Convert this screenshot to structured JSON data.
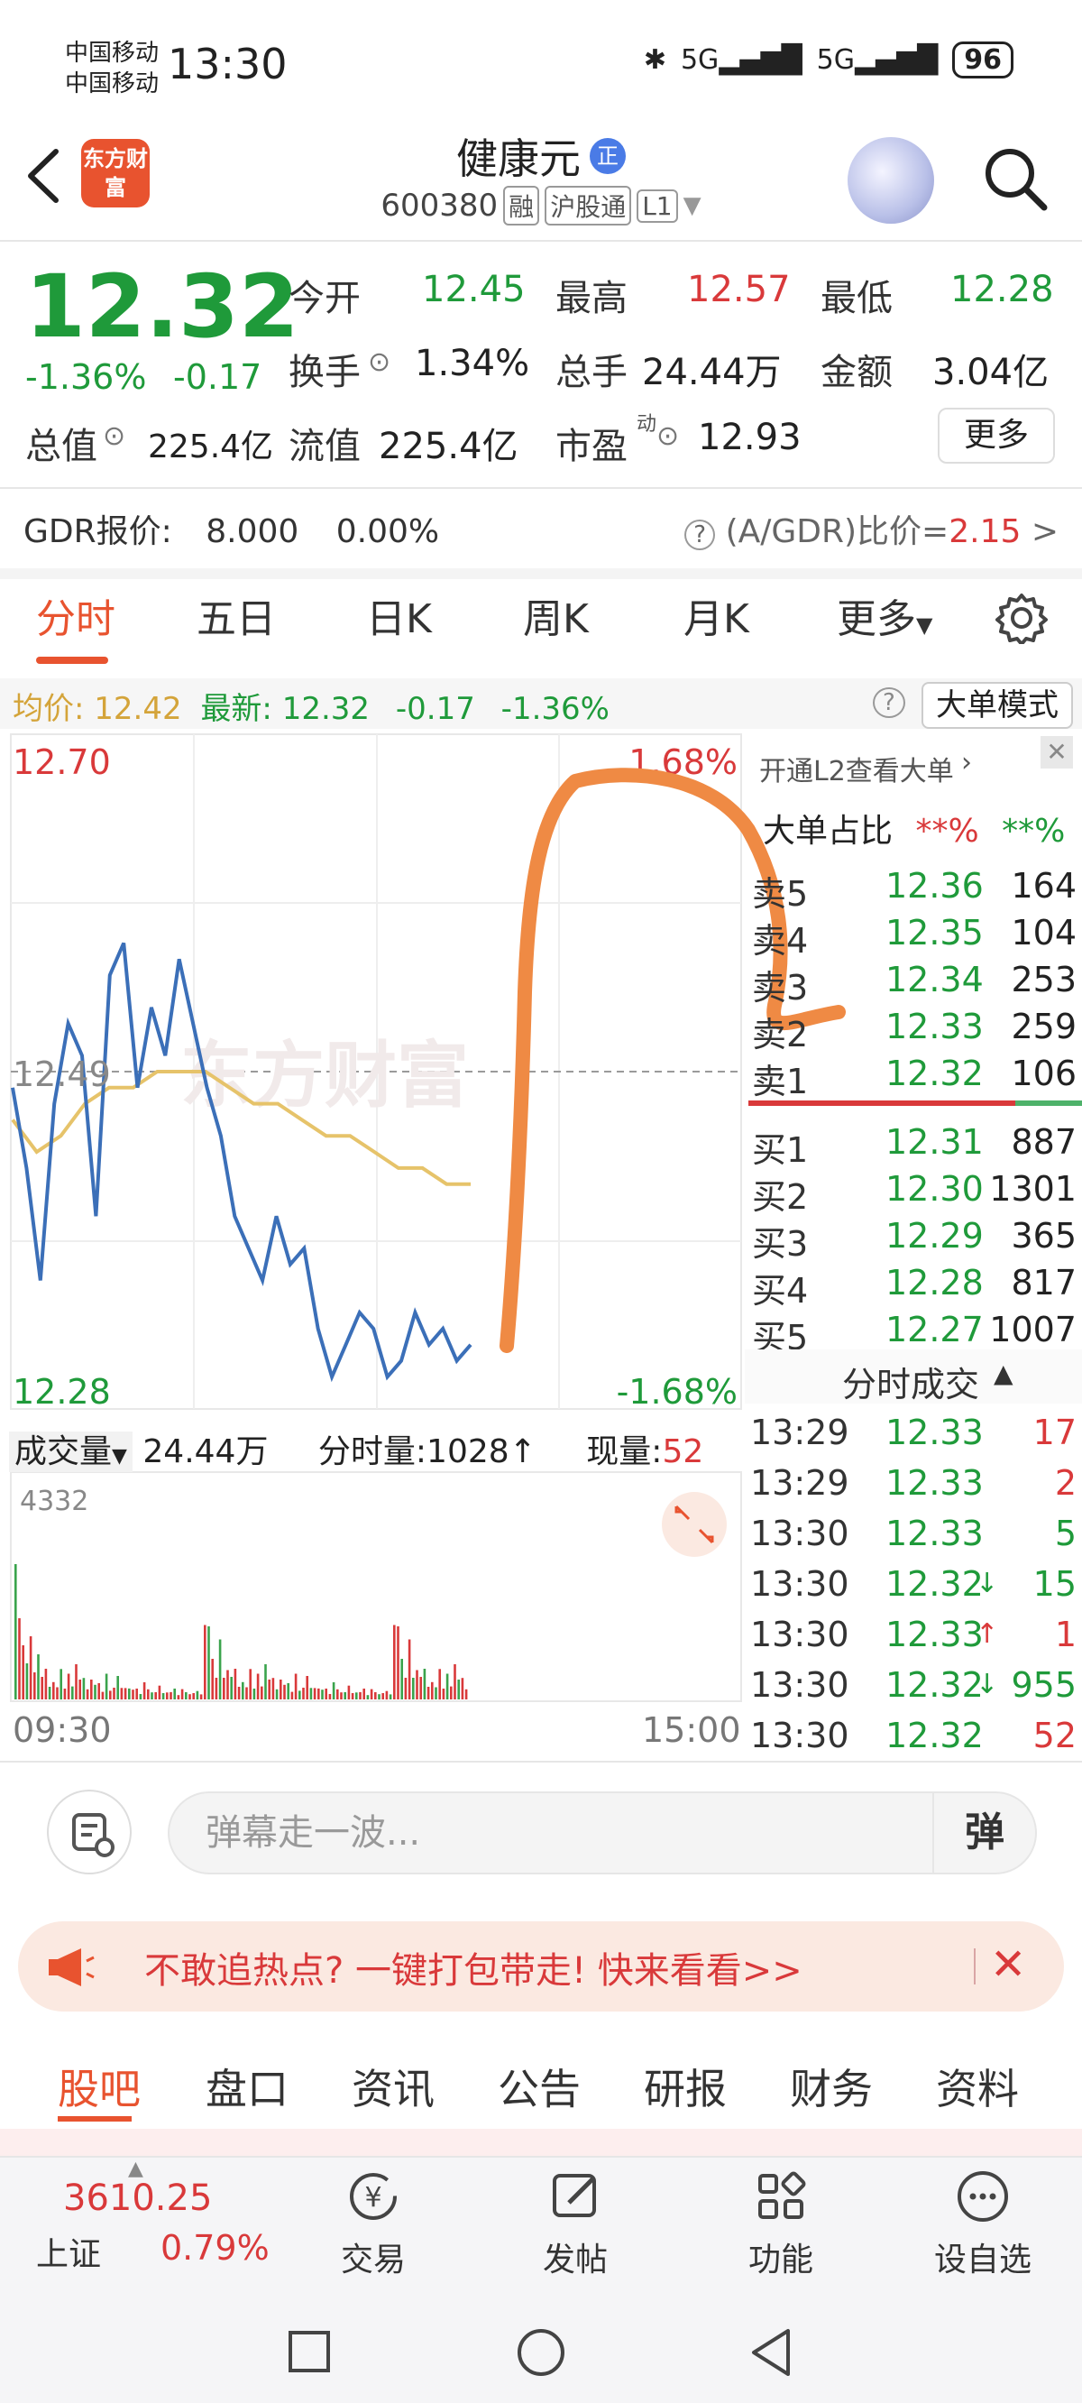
{
  "status_bar": {
    "carrier1": "中国移动",
    "carrier2": "中国移动",
    "time": "13:30",
    "signal1": "5G",
    "signal2": "5G",
    "battery": "96"
  },
  "header": {
    "logo_text": "东方财富",
    "stock_name": "健康元",
    "name_badge": "正",
    "code": "600380",
    "tag1": "融",
    "tag2": "沪股通",
    "tag3": "L1"
  },
  "quote": {
    "price": "12.32",
    "change_pct": "-1.36%",
    "change_abs": "-0.17",
    "open_label": "今开",
    "open": "12.45",
    "high_label": "最高",
    "high": "12.57",
    "low_label": "最低",
    "low": "12.28",
    "turnover_label": "换手",
    "turnover": "1.34%",
    "volume_label": "总手",
    "volume": "24.44万",
    "amount_label": "金额",
    "amount": "3.04亿",
    "mcap_label": "总值",
    "mcap": "225.4亿",
    "float_label": "流值",
    "float": "225.4亿",
    "pe_label": "市盈",
    "pe_sup": "动",
    "pe": "12.93",
    "more": "更多"
  },
  "gdr": {
    "label": "GDR报价:",
    "price": "8.000",
    "pct": "0.00%",
    "ratio_label": "(A/GDR)比价=",
    "ratio": "2.15",
    "arrow": ">"
  },
  "chart_tabs": [
    "分时",
    "五日",
    "日K",
    "周K",
    "月K",
    "更多"
  ],
  "info_strip": {
    "avg_label": "均价:",
    "avg": "12.42",
    "latest_label": "最新:",
    "latest": "12.32",
    "chg": "-0.17",
    "pct": "-1.36%",
    "big_order_mode": "大单模式"
  },
  "chart_labels": {
    "y_top": "12.70",
    "y_mid": "12.49",
    "y_bottom": "12.28",
    "pct_top": "1.68%",
    "pct_bottom": "-1.68%",
    "watermark": "东方财富"
  },
  "chart_data": {
    "type": "line",
    "title": "",
    "ylim": [
      12.28,
      12.7
    ],
    "series": [
      {
        "name": "最新",
        "values": [
          12.48,
          12.43,
          12.36,
          12.47,
          12.52,
          12.5,
          12.4,
          12.55,
          12.57,
          12.48,
          12.53,
          12.5,
          12.56,
          12.52,
          12.48,
          12.45,
          12.4,
          12.38,
          12.36,
          12.4,
          12.37,
          12.38,
          12.33,
          12.3,
          12.32,
          12.34,
          12.33,
          12.3,
          12.31,
          12.34,
          12.32,
          12.33,
          12.31,
          12.32
        ]
      },
      {
        "name": "均价",
        "values": [
          12.46,
          12.44,
          12.45,
          12.47,
          12.48,
          12.48,
          12.49,
          12.49,
          12.49,
          12.48,
          12.47,
          12.47,
          12.46,
          12.45,
          12.45,
          12.44,
          12.43,
          12.43,
          12.42,
          12.42
        ]
      }
    ]
  },
  "order_book": {
    "header_link": "开通L2查看大单",
    "ratio_label": "大单占比",
    "ratio_sell": "**%",
    "ratio_buy": "**%",
    "asks": [
      {
        "label": "卖5",
        "price": "12.36",
        "vol": "164"
      },
      {
        "label": "卖4",
        "price": "12.35",
        "vol": "104"
      },
      {
        "label": "卖3",
        "price": "12.34",
        "vol": "253"
      },
      {
        "label": "卖2",
        "price": "12.33",
        "vol": "259"
      },
      {
        "label": "卖1",
        "price": "12.32",
        "vol": "106"
      }
    ],
    "bids": [
      {
        "label": "买1",
        "price": "12.31",
        "vol": "887"
      },
      {
        "label": "买2",
        "price": "12.30",
        "vol": "1301"
      },
      {
        "label": "买3",
        "price": "12.29",
        "vol": "365"
      },
      {
        "label": "买4",
        "price": "12.28",
        "vol": "817"
      },
      {
        "label": "买5",
        "price": "12.27",
        "vol": "1007"
      }
    ]
  },
  "volume_row": {
    "label": "成交量",
    "total": "24.44万",
    "period_label": "分时量:",
    "period": "1028",
    "current_label": "现量:",
    "current": "52",
    "vol_max": "4332"
  },
  "trades": {
    "title": "分时成交",
    "rows": [
      {
        "time": "13:29",
        "price": "12.33",
        "vol": "17",
        "dir": ""
      },
      {
        "time": "13:29",
        "price": "12.33",
        "vol": "2",
        "dir": ""
      },
      {
        "time": "13:30",
        "price": "12.33",
        "vol": "5",
        "dir": ""
      },
      {
        "time": "13:30",
        "price": "12.32",
        "vol": "15",
        "dir": "↓"
      },
      {
        "time": "13:30",
        "price": "12.33",
        "vol": "1",
        "dir": "↑"
      },
      {
        "time": "13:30",
        "price": "12.32",
        "vol": "955",
        "dir": "↓"
      },
      {
        "time": "13:30",
        "price": "12.32",
        "vol": "52",
        "dir": ""
      }
    ]
  },
  "time_axis": {
    "start": "09:30",
    "end": "15:00"
  },
  "comment": {
    "placeholder": "弹幕走一波...",
    "danmu_btn": "弹"
  },
  "promo": {
    "text": "不敢追热点? 一键打包带走! 快来看看>>"
  },
  "news_tabs": [
    "股吧",
    "盘口",
    "资讯",
    "公告",
    "研报",
    "财务",
    "资料"
  ],
  "bottom_bar": {
    "index_value": "3610.25",
    "index_name": "上证",
    "index_pct": "0.79%",
    "items": [
      "交易",
      "发帖",
      "功能",
      "设自选"
    ]
  }
}
